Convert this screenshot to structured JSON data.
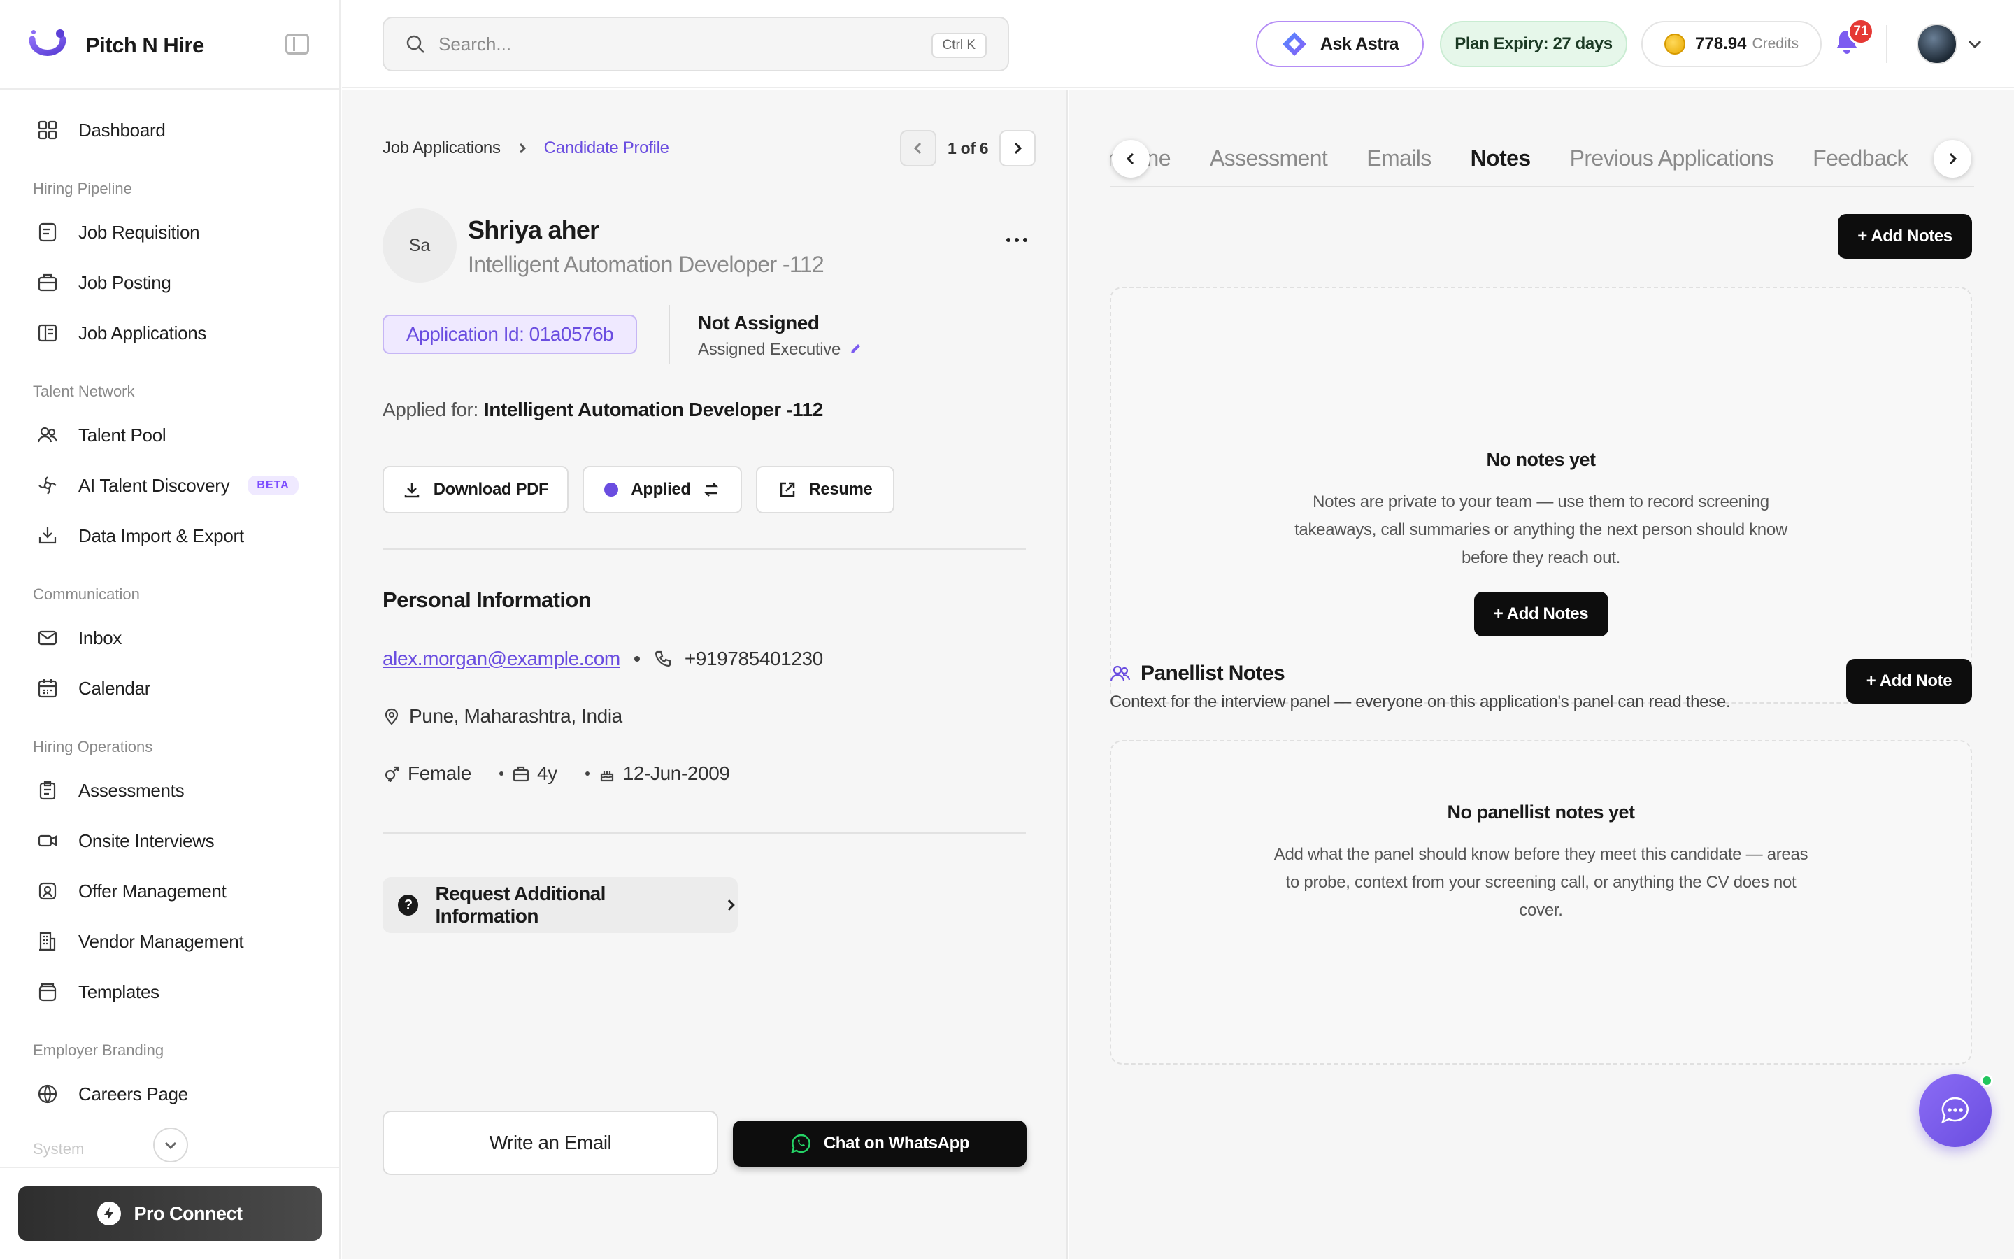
{
  "brand": {
    "name": "Pitch N Hire"
  },
  "sidebar": {
    "items": [
      {
        "label": "Dashboard"
      }
    ],
    "groups": [
      {
        "title": "Hiring Pipeline",
        "items": [
          "Job Requisition",
          "Job Posting",
          "Job Applications"
        ]
      },
      {
        "title": "Talent Network",
        "items": [
          "Talent Pool",
          "AI Talent Discovery",
          "Data Import & Export"
        ],
        "beta_label": "BETA"
      },
      {
        "title": "Communication",
        "items": [
          "Inbox",
          "Calendar"
        ]
      },
      {
        "title": "Hiring Operations",
        "items": [
          "Assessments",
          "Onsite Interviews",
          "Offer Management",
          "Vendor Management",
          "Templates"
        ]
      },
      {
        "title": "Employer Branding",
        "items": [
          "Careers Page"
        ]
      }
    ],
    "system_label": "System",
    "pro_connect_label": "Pro Connect"
  },
  "topbar": {
    "search_placeholder": "Search...",
    "search_shortcut": "Ctrl K",
    "ask_astra": "Ask Astra",
    "plan_expiry": "Plan Expiry: 27 days",
    "credits_amount": "778.94",
    "credits_unit": "Credits",
    "notification_count": "71"
  },
  "profile": {
    "breadcrumb_parent": "Job Applications",
    "breadcrumb_current": "Candidate Profile",
    "pager_text": "1 of 6",
    "initials": "Sa",
    "name": "Shriya aher",
    "role": "Intelligent Automation Developer -112",
    "application_id": "Application Id: 01a0576b",
    "assignment_title": "Not Assigned",
    "assignment_sub": "Assigned Executive",
    "applied_for_label": "Applied for:",
    "applied_for_value": "Intelligent Automation Developer -112",
    "download_pdf": "Download PDF",
    "status": "Applied",
    "resume": "Resume",
    "personal_info_title": "Personal Information",
    "email": "alex.morgan@example.com",
    "phone": "+919785401230",
    "location": "Pune, Maharashtra, India",
    "gender": "Female",
    "experience": "4y",
    "dob": "12-Jun-2009",
    "request_info": "Request Additional Information",
    "write_email": "Write an Email",
    "whatsapp": "Chat on WhatsApp"
  },
  "tabs": [
    "Timeline",
    "Assessment",
    "Emails",
    "Notes",
    "Previous Applications",
    "Feedback"
  ],
  "active_tab": "Notes",
  "notes": {
    "add_notes_label": "+ Add Notes",
    "empty_title": "No notes yet",
    "empty_desc": "Notes are private to your team — use them to record screening takeaways, call summaries or anything the next person should know before they reach out.",
    "empty_btn": "+ Add Notes"
  },
  "panellist": {
    "title": "Panellist Notes",
    "subtitle": "Context for the interview panel — everyone on this application's panel can read these.",
    "add_note_label": "+ Add Note",
    "empty_title": "No panellist notes yet",
    "empty_desc": "Add what the panel should know before they meet this candidate — areas to probe, context from your screening call, or anything the CV does not cover."
  },
  "colors": {
    "accent": "#6a4de0",
    "primary_button": "#0d0d0d",
    "plan_bg": "#e6f7ea",
    "badge": "#e53935"
  }
}
